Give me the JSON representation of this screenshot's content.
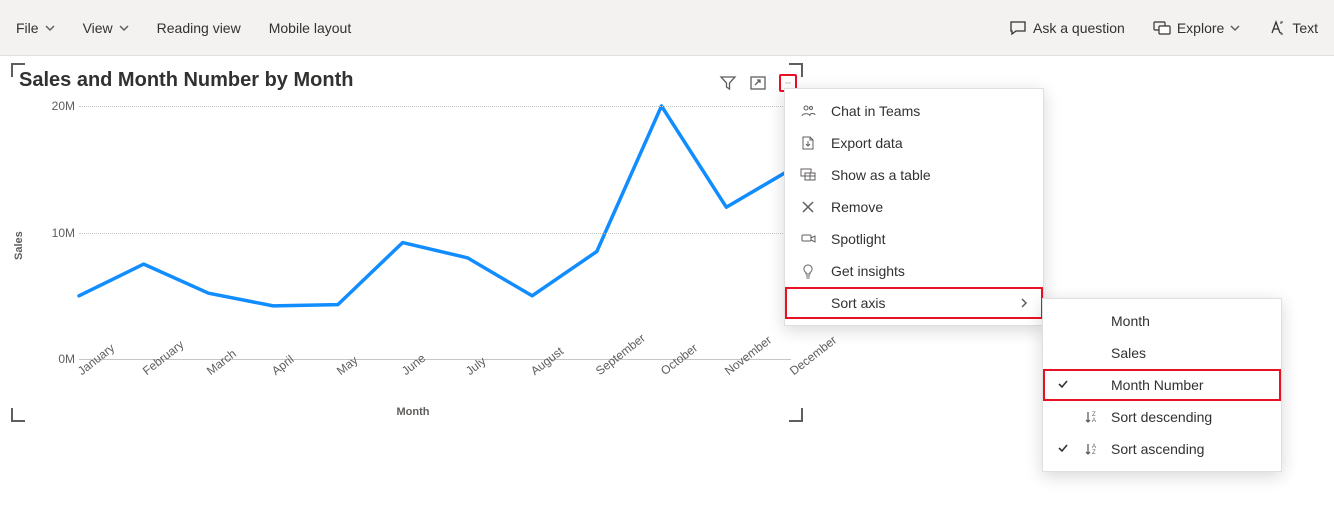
{
  "toolbar": {
    "file": "File",
    "view": "View",
    "reading_view": "Reading view",
    "mobile_layout": "Mobile layout",
    "ask": "Ask a question",
    "explore": "Explore",
    "text": "Text"
  },
  "chart": {
    "title": "Sales and Month Number by Month",
    "ylabel": "Sales",
    "xlabel": "Month",
    "yticks": [
      "0M",
      "10M",
      "20M"
    ]
  },
  "chart_data": {
    "type": "line",
    "title": "Sales and Month Number by Month",
    "xlabel": "Month",
    "ylabel": "Sales",
    "ylim": [
      0,
      20
    ],
    "y_unit": "M",
    "categories": [
      "January",
      "February",
      "March",
      "April",
      "May",
      "June",
      "July",
      "August",
      "September",
      "October",
      "November",
      "December"
    ],
    "values": [
      5.0,
      7.5,
      5.2,
      4.2,
      4.3,
      9.2,
      8.0,
      5.0,
      8.5,
      20.0,
      12.0,
      15.0
    ]
  },
  "context_menu": {
    "chat": "Chat in Teams",
    "export": "Export data",
    "table": "Show as a table",
    "remove": "Remove",
    "spotlight": "Spotlight",
    "insights": "Get insights",
    "sort_axis": "Sort axis"
  },
  "sub_menu": {
    "month": "Month",
    "sales": "Sales",
    "month_number": "Month Number",
    "sort_desc": "Sort descending",
    "sort_asc": "Sort ascending"
  }
}
